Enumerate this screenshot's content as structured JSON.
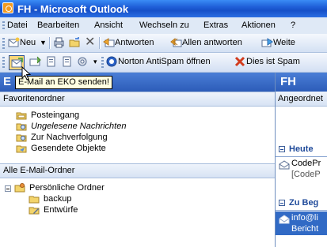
{
  "window": {
    "title": "FH - Microsoft Outlook"
  },
  "menu": {
    "items": [
      {
        "label": "Datei"
      },
      {
        "label": "Bearbeiten"
      },
      {
        "label": "Ansicht"
      },
      {
        "label": "Wechseln zu"
      },
      {
        "label": "Extras"
      },
      {
        "label": "Aktionen"
      },
      {
        "label": "?"
      }
    ]
  },
  "toolbar1": {
    "new_label": "Neu",
    "reply_label": "Antworten",
    "reply_all_label": "Allen antworten",
    "forward_label": "Weite"
  },
  "toolbar2": {
    "norton_label": "Norton AntiSpam öffnen",
    "spam_label": "Dies ist Spam"
  },
  "tooltip": {
    "text": "E-Mail an EKO senden!"
  },
  "left_pane": {
    "header_title": "E",
    "favorites_label": "Favoritenordner",
    "favorites": [
      {
        "label": "Posteingang",
        "icon": "inbox-folder-icon"
      },
      {
        "label": "Ungelesene Nachrichten",
        "icon": "search-folder-icon"
      },
      {
        "label": "Zur Nachverfolgung",
        "icon": "search-folder-icon"
      },
      {
        "label": "Gesendete Objekte",
        "icon": "sent-folder-icon"
      }
    ],
    "all_folders_label": "Alle E-Mail-Ordner",
    "tree": [
      {
        "label": "Persönliche Ordner",
        "icon": "personal-folders-icon"
      },
      {
        "label": "backup",
        "icon": "folder-icon"
      },
      {
        "label": "Entwürfe",
        "icon": "drafts-folder-icon"
      }
    ]
  },
  "right_pane": {
    "header_title": "FH",
    "sort_label": "Angeordnet",
    "group_today": "Heute",
    "row1_line1": "CodePr",
    "row1_line2": "[CodeP",
    "group_second": "Zu Beg",
    "row2_line1": "info@li",
    "row2_line2": "Bericht"
  },
  "colors": {
    "title_bar": "#1f5fd8",
    "pane_header": "#2c5cb8",
    "tooltip_bg": "#ffffe1",
    "selection": "#316ac5"
  }
}
